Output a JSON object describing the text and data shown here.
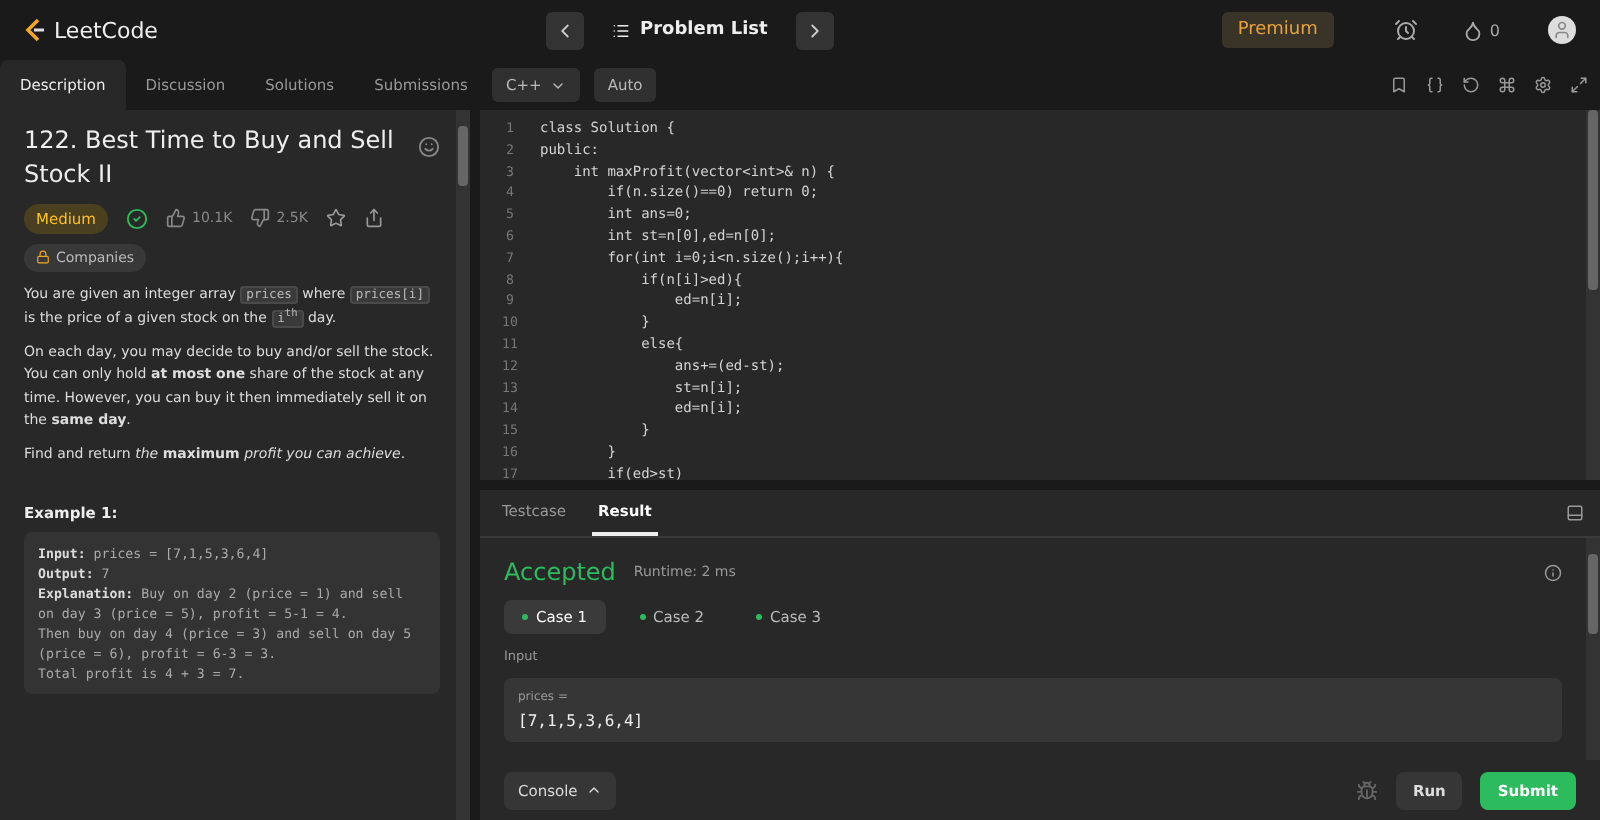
{
  "topbar": {
    "logo": "LeetCode",
    "problem_list": "Problem List",
    "premium": "Premium",
    "streak": "0"
  },
  "left_tabs": [
    {
      "label": "Description",
      "selected": true
    },
    {
      "label": "Discussion",
      "selected": false
    },
    {
      "label": "Solutions",
      "selected": false
    },
    {
      "label": "Submissions",
      "selected": false
    }
  ],
  "problem": {
    "title": "122. Best Time to Buy and Sell Stock II",
    "difficulty": "Medium",
    "solved": true,
    "likes": "10.1K",
    "dislikes": "2.5K",
    "companies": "Companies",
    "paragraphs": [
      [
        {
          "kind": "text",
          "text": "You are given an integer array "
        },
        {
          "kind": "code",
          "text": "prices"
        },
        {
          "kind": "text",
          "text": " where "
        },
        {
          "kind": "code",
          "text": "prices[i]"
        },
        {
          "kind": "text",
          "text": " is the price of a given stock on the "
        },
        {
          "kind": "code",
          "text": "i$^{th}$"
        },
        {
          "kind": "text",
          "text": " day."
        }
      ],
      [
        {
          "kind": "text",
          "text": "On each day, you may decide to buy and/or sell the stock. You can only hold **at most one** share of the stock at any time. However, you can buy it then immediately sell it on the **same day**."
        }
      ],
      [
        {
          "kind": "text",
          "text": "Find and return *the* **maximum** *profit you can achieve*."
        }
      ]
    ],
    "example_title": "Example 1:",
    "example_lines": [
      "**Input:** prices = [7,1,5,3,6,4]",
      "**Output:** 7",
      "**Explanation:** Buy on day 2 (price = 1) and sell on day 3 (price = 5), profit = 5-1 = 4.",
      "Then buy on day 4 (price = 3) and sell on day 5 (price = 6), profit = 6-3 = 3.",
      "Total profit is 4 + 3 = 7."
    ]
  },
  "editor": {
    "language": "C++",
    "mode": "Auto",
    "line_numbers": [
      "1",
      "2",
      "3",
      "4",
      "5",
      "6",
      "7",
      "8",
      "9",
      "10",
      "11",
      "12",
      "13",
      "14",
      "15",
      "16",
      "17"
    ],
    "lines": [
      "class Solution {",
      "public:",
      "    int maxProfit(vector<int>& n) {",
      "        if(n.size()==0) return 0;",
      "        int ans=0;",
      "        int st=n[0],ed=n[0];",
      "        for(int i=0;i<n.size();i++){",
      "            if(n[i]>ed){",
      "                ed=n[i];",
      "            }",
      "            else{",
      "                ans+=(ed-st);",
      "                st=n[i];",
      "                ed=n[i];",
      "            }",
      "        }",
      "        if(ed>st)"
    ]
  },
  "bottom_tabs": [
    {
      "label": "Testcase",
      "selected": false
    },
    {
      "label": "Result",
      "selected": true
    }
  ],
  "result": {
    "status": "Accepted",
    "runtime": "Runtime: 2 ms",
    "cases": [
      {
        "label": "Case 1",
        "selected": true
      },
      {
        "label": "Case 2",
        "selected": false
      },
      {
        "label": "Case 3",
        "selected": false
      }
    ],
    "input_label": "Input",
    "param_name": "prices =",
    "param_value": "[7,1,5,3,6,4]"
  },
  "footer": {
    "console": "Console",
    "run": "Run",
    "submit": "Submit"
  }
}
